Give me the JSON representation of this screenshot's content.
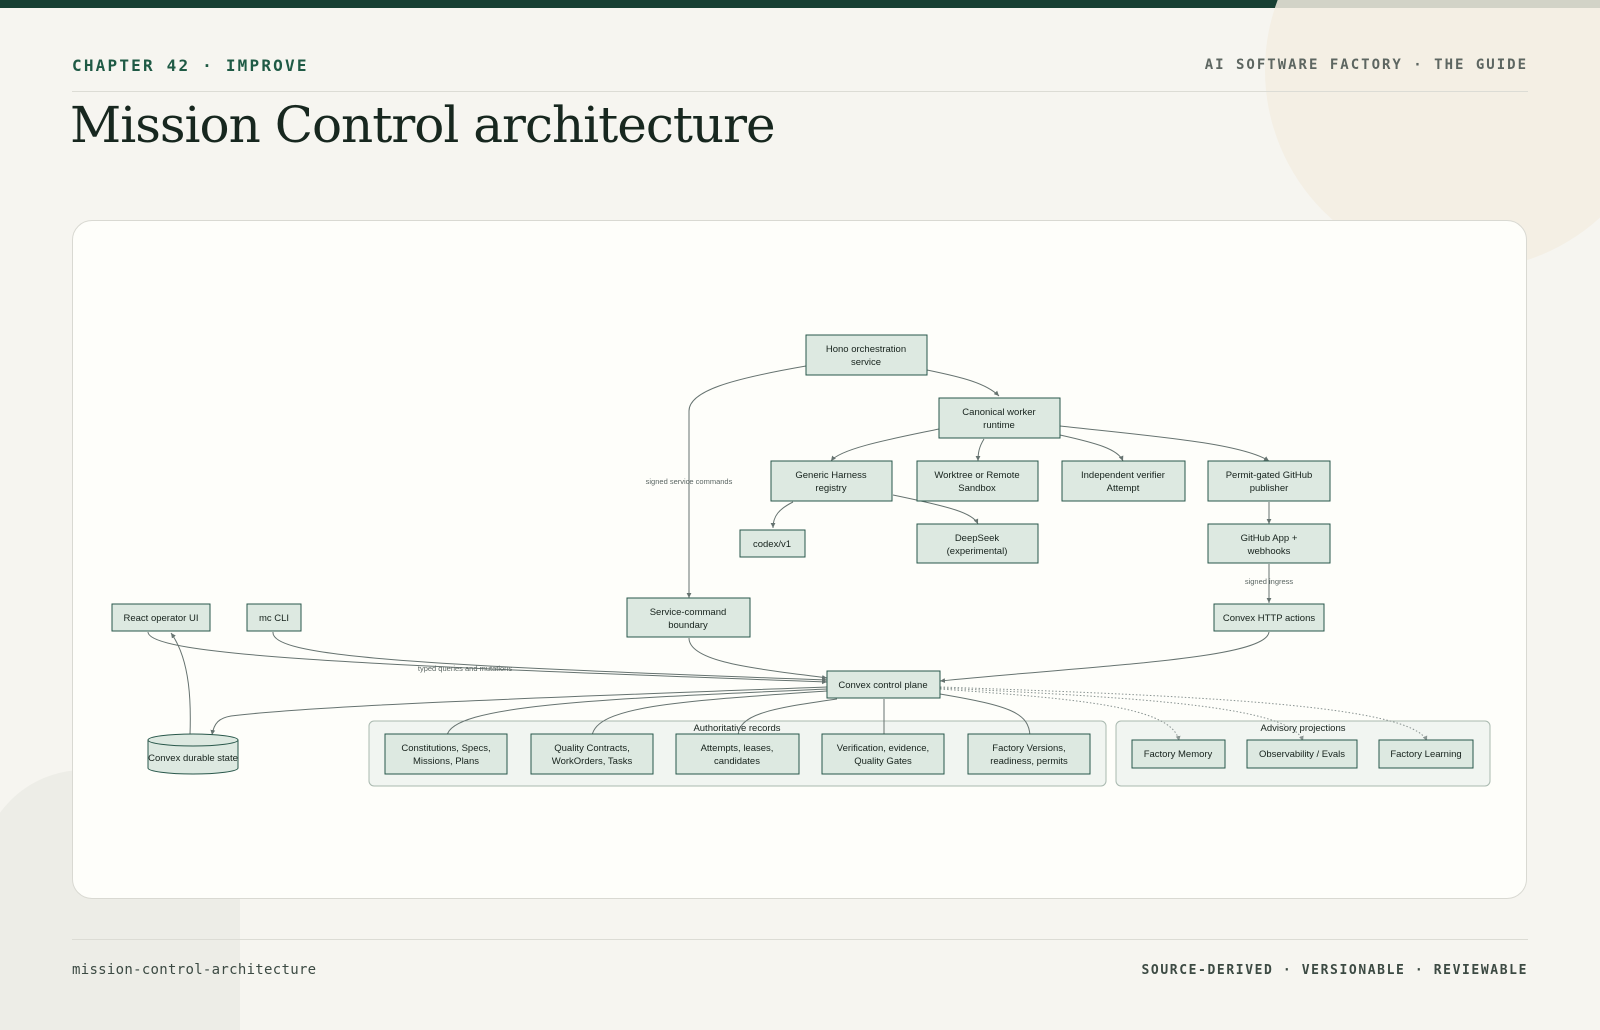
{
  "header": {
    "chapter": "CHAPTER 42 · IMPROVE",
    "guide": "AI SOFTWARE FACTORY · THE GUIDE",
    "title": "Mission Control architecture"
  },
  "footer": {
    "slug": "mission-control-architecture",
    "tagline": "SOURCE-DERIVED · VERSIONABLE · REVIEWABLE"
  },
  "colors": {
    "accent": "#173f33",
    "node_fill": "#dde9e1",
    "node_stroke": "#28574a"
  },
  "diagram": {
    "nodes": {
      "hono": [
        "Hono orchestration",
        "service"
      ],
      "worker": [
        "Canonical worker",
        "runtime"
      ],
      "harness": [
        "Generic Harness",
        "registry"
      ],
      "worktree": [
        "Worktree or Remote",
        "Sandbox"
      ],
      "verifier": [
        "Independent verifier",
        "Attempt"
      ],
      "publisher": [
        "Permit-gated GitHub",
        "publisher"
      ],
      "codex": [
        "codex/v1"
      ],
      "deepseek": [
        "DeepSeek",
        "(experimental)"
      ],
      "github_app": [
        "GitHub App +",
        "webhooks"
      ],
      "service_cmd": [
        "Service-command",
        "boundary"
      ],
      "react_ui": [
        "React operator UI"
      ],
      "mc_cli": [
        "mc CLI"
      ],
      "http_actions": [
        "Convex HTTP actions"
      ],
      "control_plane": [
        "Convex control plane"
      ],
      "durable_state": [
        "Convex durable state"
      ],
      "constitutions": [
        "Constitutions, Specs,",
        "Missions, Plans"
      ],
      "quality": [
        "Quality Contracts,",
        "WorkOrders, Tasks"
      ],
      "attempts": [
        "Attempts, leases,",
        "candidates"
      ],
      "verification": [
        "Verification, evidence,",
        "Quality Gates"
      ],
      "factory_versions": [
        "Factory Versions,",
        "readiness, permits"
      ],
      "memory": [
        "Factory Memory"
      ],
      "observability": [
        "Observability / Evals"
      ],
      "learning": [
        "Factory Learning"
      ]
    },
    "groups": {
      "authoritative": "Authoritative records",
      "advisory": "Advisory projections"
    },
    "edge_labels": {
      "signed_commands": "signed service commands",
      "signed_ingress": "signed ingress",
      "typed_queries": "typed queries and mutations"
    }
  }
}
